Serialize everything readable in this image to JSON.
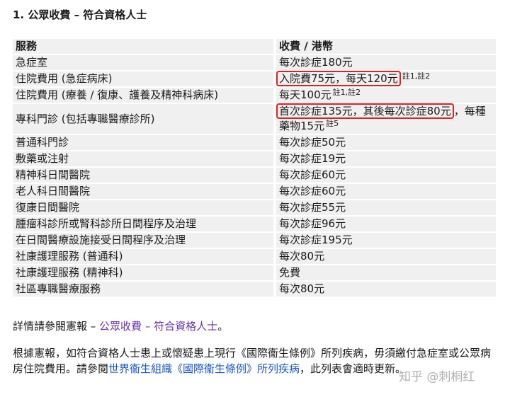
{
  "heading": "1. 公眾收費 – 符合資格人士",
  "table": {
    "headers": [
      "服務",
      "收費 / 港幣"
    ],
    "rows": [
      {
        "service": "急症室",
        "fee": "每次診症180元"
      },
      {
        "service": "住院費用 (急症病床)",
        "fee": "入院費75元，每天120元",
        "note": "註1,註2"
      },
      {
        "service": "住院費用 (療養 / 復康、護養及精神科病床)",
        "fee": "每天100元",
        "note": "註1,註2"
      },
      {
        "service": "專科門診 (包括專職醫療診所)",
        "fee": "首次診症135元，其後每次診症80元",
        "fee_rest": "，每種藥物15元",
        "note": "註5"
      },
      {
        "service": "普通科門診",
        "fee": "每次診症50元"
      },
      {
        "service": "敷藥或注射",
        "fee": "每次診症19元"
      },
      {
        "service": "精神科日間醫院",
        "fee": "每次診症60元"
      },
      {
        "service": "老人科日間醫院",
        "fee": "每次診症60元"
      },
      {
        "service": "復康日間醫院",
        "fee": "每次診症55元"
      },
      {
        "service": "腫瘤科診所或腎科診所日間程序及治理",
        "fee": "每次診症96元"
      },
      {
        "service": "在日間醫療設施接受日間程序及治理",
        "fee": "每次診症195元"
      },
      {
        "service": "社康護理服務 (普通科)",
        "fee": "每次80元"
      },
      {
        "service": "社康護理服務 (精神科)",
        "fee": "免費"
      },
      {
        "service": "社區專職醫療服務",
        "fee": "每次80元"
      }
    ]
  },
  "para1": {
    "prefix": "詳情請參閱憲報 – ",
    "link": "公眾收費 – 符合資格人士",
    "suffix": "。"
  },
  "para2": {
    "prefix": "根據憲報，如符合資格人士患上或懷疑患上現行《國際衞生條例》所列疾病，毋須繳付急症室或公眾病房住院費用。請參閱",
    "link": "世界衞生組織《國際衞生條例》所列疾病",
    "suffix": "，此列表會適時更新。"
  },
  "watermark": "知乎 @刺桐红",
  "colors": {
    "highlight": "#e0201e",
    "link": "#6b2fb3",
    "link2": "#1a55c9",
    "row_bg": "#f0f0f0"
  }
}
